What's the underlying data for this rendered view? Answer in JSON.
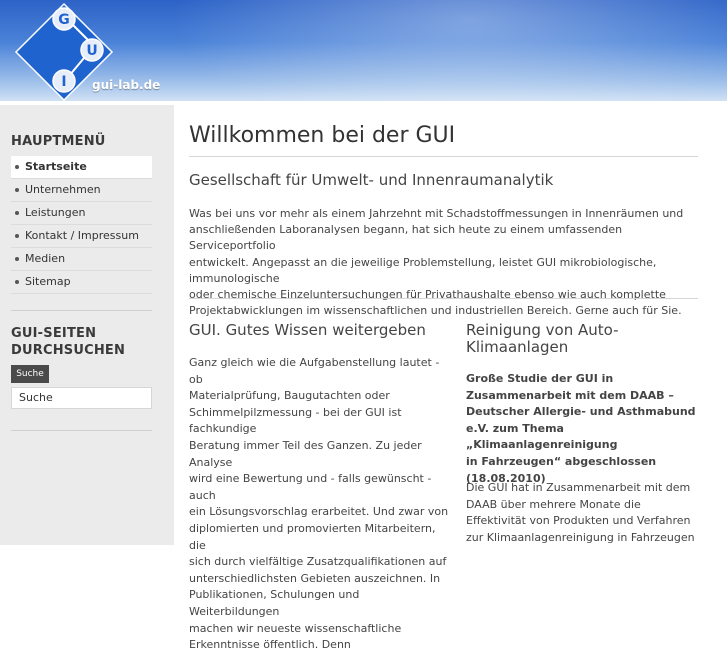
{
  "header": {
    "logo_letters": [
      "G",
      "U",
      "I"
    ],
    "logo_text": "gui-lab.de",
    "colors": {
      "bar_top": "#2d63c7",
      "bar_bottom": "#dbe8f7",
      "logo_diamond": "#1f63cf"
    }
  },
  "sidebar": {
    "menu_heading": "HAUPTMENÜ",
    "menu_items": [
      {
        "label": "Startseite",
        "active": true
      },
      {
        "label": "Unternehmen",
        "active": false
      },
      {
        "label": "Leistungen",
        "active": false
      },
      {
        "label": "Kontakt / Impressum",
        "active": false
      },
      {
        "label": "Medien",
        "active": false
      },
      {
        "label": "Sitemap",
        "active": false
      }
    ],
    "search_heading_line1": "GUI-SEITEN",
    "search_heading_line2": "DURCHSUCHEN",
    "search_button": "Suche",
    "search_value": "Suche"
  },
  "main": {
    "title": "Willkommen bei der GUI",
    "subtitle": "Gesellschaft für Umwelt- und Innenraumanalytik",
    "intro_lines": [
      "Was bei uns vor mehr als einem Jahrzehnt mit Schadstoffmessungen in Innenräumen und",
      "anschließenden Laboranalysen begann, hat sich heute zu einem umfassenden Serviceportfolio",
      "entwickelt. Angepasst an die jeweilige Problemstellung, leistet GUI mikrobiologische, immunologische",
      "oder chemische Einzeluntersuchungen für Privathaushalte ebenso wie auch komplette",
      "Projektabwicklungen im wissenschaftlichen und industriellen Bereich. Gerne auch für Sie."
    ],
    "left_column": {
      "heading": "GUI. Gutes Wissen weitergeben",
      "lines": [
        "Ganz gleich wie die Aufgabenstellung lautet - ob",
        "Materialprüfung, Baugutachten oder",
        "Schimmelpilzmessung - bei der GUI ist fachkundige",
        "Beratung immer Teil des Ganzen. Zu jeder Analyse",
        "wird eine Bewertung und - falls gewünscht - auch",
        "ein Lösungsvorschlag erarbeitet. Und zwar von",
        "diplomierten und promovierten Mitarbeitern, die",
        "sich durch vielfältige Zusatzqualifikationen auf",
        "unterschiedlichsten Gebieten auszeichnen. In",
        "Publikationen, Schulungen und Weiterbildungen",
        "machen wir neueste wissenschaftliche",
        "Erkenntnisse öffentlich. Denn"
      ]
    },
    "right_column": {
      "heading_line1": "Reinigung von Auto-",
      "heading_line2": "Klimaanlagen",
      "bold_lines": [
        "Große Studie der GUI in",
        "Zusammenarbeit mit dem DAAB –",
        "Deutscher Allergie- und Asthmabund",
        "e.V. zum Thema „Klimaanlagenreinigung",
        "in Fahrzeugen“ abgeschlossen",
        "(18.08.2010)"
      ],
      "lines": [
        "Die GUI hat in Zusammenarbeit mit dem",
        "DAAB über mehrere Monate die",
        "Effektivität von Produkten und Verfahren",
        "zur Klimaanlagenreinigung in Fahrzeugen"
      ]
    }
  }
}
